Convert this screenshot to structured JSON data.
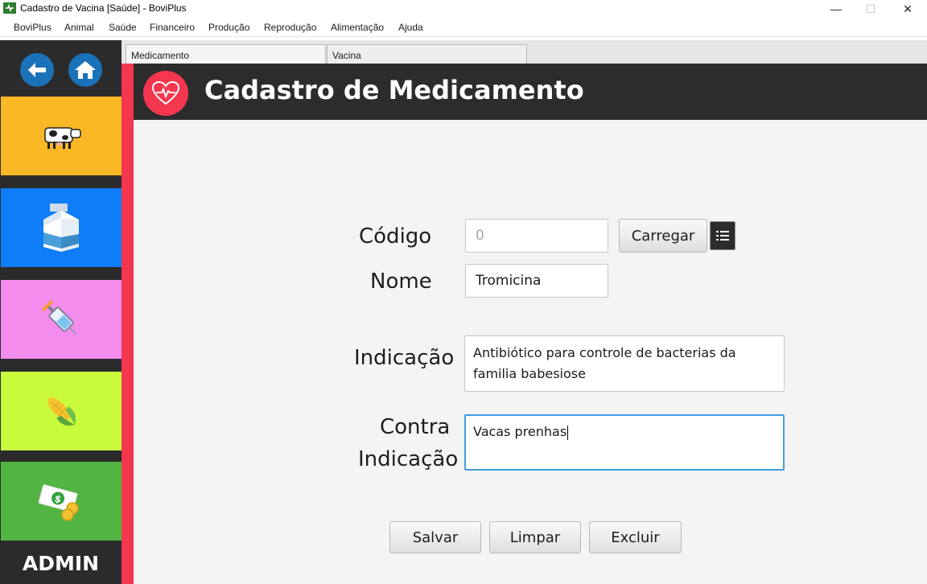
{
  "window": {
    "title": "Cadastro de Vacina [Saúde] - BoviPlus",
    "minimize": "—",
    "maximize": "☐",
    "close": "✕"
  },
  "menu": [
    "BoviPlus",
    "Animal",
    "Saúde",
    "Financeiro",
    "Produção",
    "Reprodução",
    "Alimentação",
    "Ajuda"
  ],
  "sidebar": {
    "back_icon": "arrow-left-icon",
    "home_icon": "home-icon",
    "tiles": [
      {
        "icon": "cow-icon",
        "color": "#fbb825"
      },
      {
        "icon": "milk-carton-icon",
        "color": "#0f7df8"
      },
      {
        "icon": "syringe-icon",
        "color": "#f48cee"
      },
      {
        "icon": "corn-icon",
        "color": "#c9fb3c"
      },
      {
        "icon": "money-icon",
        "color": "#52b443"
      }
    ],
    "user_label": "ADMIN"
  },
  "tabs": [
    {
      "label": "Medicamento",
      "active": true
    },
    {
      "label": "Vacina",
      "active": false
    }
  ],
  "header": {
    "title": "Cadastro de Medicamento",
    "icon": "heart-pulse-icon"
  },
  "form": {
    "codigo": {
      "label": "Código",
      "value": "0"
    },
    "carregar_label": "Carregar",
    "list_icon": "list-icon",
    "nome": {
      "label": "Nome",
      "value": "Tromicina"
    },
    "indicacao": {
      "label": "Indicação",
      "value": "Antibiótico para controle de bacterias da familia babesiose"
    },
    "contra_indicacao": {
      "label_line1": "Contra",
      "label_line2": "Indicação",
      "value": "Vacas prenhas"
    }
  },
  "actions": {
    "save": "Salvar",
    "clear": "Limpar",
    "delete": "Excluir"
  },
  "colors": {
    "accent_red": "#f5364f",
    "header_dark": "#2c2c2c",
    "focus_blue": "#3f9ee0"
  }
}
